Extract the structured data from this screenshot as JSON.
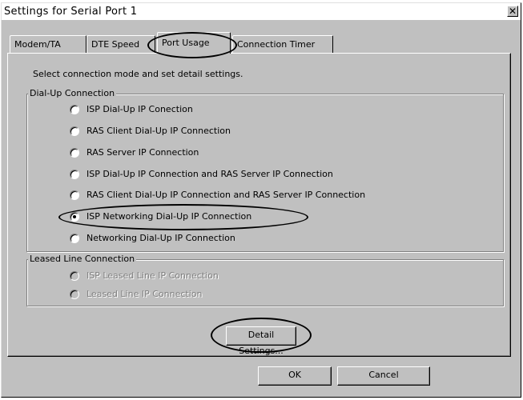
{
  "window": {
    "title": "Settings for Serial Port 1",
    "close_glyph": "✕"
  },
  "tabs": [
    {
      "label": "Modem/TA",
      "active": false
    },
    {
      "label": "DTE Speed",
      "active": false
    },
    {
      "label": "Port Usage",
      "active": true
    },
    {
      "label": "Connection Timer",
      "active": false
    }
  ],
  "instruction": "Select connection mode and set detail settings.",
  "dialup_group": {
    "label": "Dial-Up Connection",
    "options": [
      {
        "label": "ISP Dial-Up IP Conection",
        "selected": false
      },
      {
        "label": "RAS Client Dial-Up IP Connection",
        "selected": false
      },
      {
        "label": "RAS Server IP Connection",
        "selected": false
      },
      {
        "label": "ISP Dial-Up IP Connection and RAS Server IP Connection",
        "selected": false
      },
      {
        "label": "RAS Client Dial-Up IP Connection and RAS Server IP Connection",
        "selected": false
      },
      {
        "label": "ISP Networking Dial-Up IP Connection",
        "selected": true
      },
      {
        "label": "Networking Dial-Up IP Connection",
        "selected": false
      }
    ]
  },
  "leased_group": {
    "label": "Leased Line Connection",
    "options": [
      {
        "label": "ISP Leased Line IP Connection",
        "enabled": false
      },
      {
        "label": "Leased Line IP Connection",
        "enabled": false
      }
    ]
  },
  "buttons": {
    "detail_settings": "Detail Settings...",
    "ok": "OK",
    "cancel": "Cancel"
  },
  "colors": {
    "face": "#c0c0c0",
    "shadow": "#808080",
    "highlight": "#ffffff",
    "disabled_text": "#808080"
  }
}
